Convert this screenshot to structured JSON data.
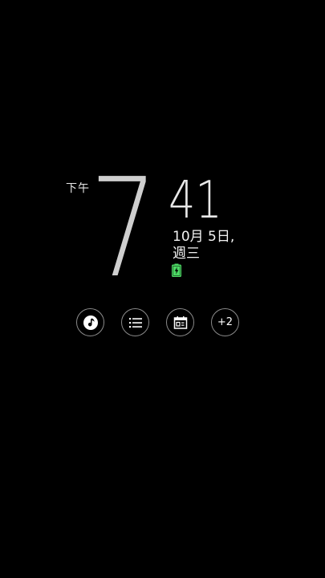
{
  "clock": {
    "ampm": "下午",
    "hour": "7",
    "minute": "41"
  },
  "date": {
    "date_text": "10月 5日,",
    "weekday_text": "週三"
  },
  "battery": {
    "status": "charging",
    "color": "#4cd964"
  },
  "apps": {
    "items": [
      {
        "icon": "music-note-icon"
      },
      {
        "icon": "list-icon"
      },
      {
        "icon": "calendar-icon"
      },
      {
        "icon": "more-count",
        "label": "+2"
      }
    ]
  },
  "colors": {
    "background": "#000000",
    "hour_digit": "#cfcfcf",
    "text": "#f2f2f2",
    "ring": "#8a8a8a"
  }
}
